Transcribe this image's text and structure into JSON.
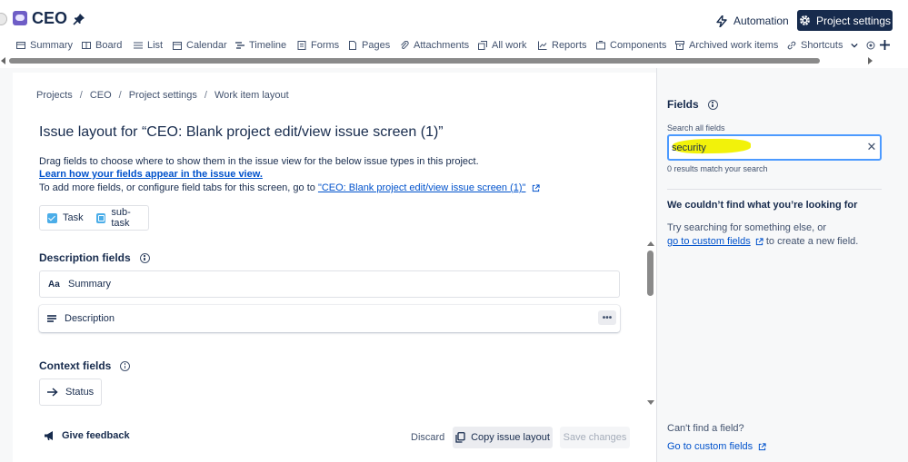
{
  "header": {
    "project_name": "CEO",
    "automation_label": "Automation",
    "project_settings_label": "Project settings"
  },
  "tabs": [
    {
      "label": "Summary",
      "icon": "summary-icon"
    },
    {
      "label": "Board",
      "icon": "board-icon"
    },
    {
      "label": "List",
      "icon": "list-icon"
    },
    {
      "label": "Calendar",
      "icon": "calendar-icon"
    },
    {
      "label": "Timeline",
      "icon": "timeline-icon"
    },
    {
      "label": "Forms",
      "icon": "forms-icon"
    },
    {
      "label": "Pages",
      "icon": "pages-icon"
    },
    {
      "label": "Attachments",
      "icon": "attachment-icon"
    },
    {
      "label": "All work",
      "icon": "all-work-icon"
    },
    {
      "label": "Reports",
      "icon": "reports-icon"
    },
    {
      "label": "Components",
      "icon": "components-icon"
    },
    {
      "label": "Archived work items",
      "icon": "archive-icon"
    },
    {
      "label": "Shortcuts",
      "icon": "shortcuts-icon"
    }
  ],
  "breadcrumb": [
    "Projects",
    "CEO",
    "Project settings",
    "Work item layout"
  ],
  "page_title": "Issue layout for “CEO: Blank project edit/view issue screen (1)”",
  "description": {
    "line1": "Drag fields to choose where to show them in the issue view for the below issue types in this project.",
    "learn_link": "Learn how your fields appear in the issue view.",
    "line3_prefix": "To add more fields, or configure field tabs for this screen, go to ",
    "screen_link": "\"CEO: Blank project edit/view issue screen (1)\""
  },
  "issue_types": [
    "Task",
    "sub-task"
  ],
  "description_fields": {
    "heading": "Description fields",
    "fields": [
      "Summary",
      "Description"
    ]
  },
  "context_fields": {
    "heading": "Context fields",
    "fields": [
      "Status"
    ]
  },
  "footer": {
    "feedback_label": "Give feedback",
    "discard_label": "Discard",
    "copy_label": "Copy issue layout",
    "save_label": "Save changes"
  },
  "right_panel": {
    "title": "Fields",
    "search_label": "Search all fields",
    "search_value": "security",
    "result_count": "0 results match your search",
    "not_found_title": "We couldn’t find what you’re looking for",
    "not_found_line1": "Try searching for something else, or",
    "custom_fields_link": "go to custom fields",
    "not_found_suffix": " to create a new field.",
    "cant_find": "Can't find a field?",
    "goto_custom_fields": "Go to custom fields"
  },
  "colors": {
    "primary_button": "#172b4d",
    "link": "#0052cc",
    "focus_border": "#4c9aff",
    "highlight": "#f2f20a",
    "issue_type_icon": "#4bade8"
  }
}
